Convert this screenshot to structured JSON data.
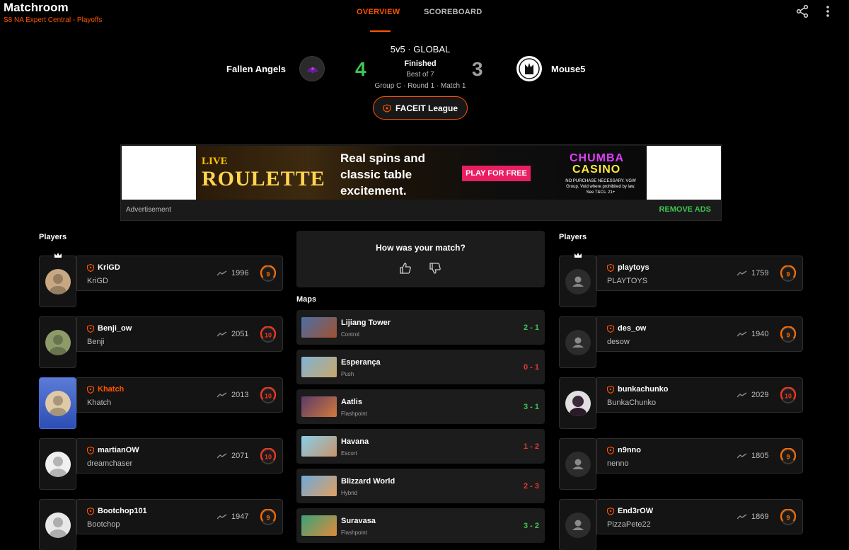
{
  "header": {
    "title": "Matchroom",
    "subtitle": "S8 NA Expert Central - Playoffs",
    "tabs": [
      {
        "label": "OVERVIEW",
        "active": true
      },
      {
        "label": "SCOREBOARD",
        "active": false
      }
    ],
    "icons": [
      "share-icon",
      "more-vertical-icon"
    ]
  },
  "match": {
    "mode": "5v5 · GLOBAL",
    "status": "Finished",
    "best_of": "Best of 7",
    "round_info": "Group C · Round 1 · Match 1",
    "league": "FACEIT League",
    "team1": {
      "name": "Fallen Angels",
      "score": "4",
      "color": "#3ec453"
    },
    "team2": {
      "name": "Mouse5",
      "score": "3",
      "color": "#9e9e9e"
    }
  },
  "ad": {
    "label": "Advertisement",
    "remove": "REMOVE ADS",
    "banner": {
      "live": "LIVE",
      "roulette": "ROULETTE",
      "headline": "Real spins and classic table excitement.",
      "cta": "PLAY FOR FREE",
      "brand1": "CHUMBA",
      "brand2": "CASINO",
      "fine1": "NO PURCHASE NECESSARY. VGW",
      "fine2": "Group. Void where prohibited by law.",
      "fine3": "See T&Cs. 21+"
    }
  },
  "players_label": "Players",
  "team1_players": [
    {
      "nick": "KriGD",
      "name": "KriGD",
      "elo": "1996",
      "level": "9",
      "highlight": false,
      "crown": true
    },
    {
      "nick": "Benji_ow",
      "name": "Benji",
      "elo": "2051",
      "level": "10",
      "highlight": false,
      "crown": false
    },
    {
      "nick": "Khatch",
      "name": "Khatch",
      "elo": "2013",
      "level": "10",
      "highlight": true,
      "crown": false
    },
    {
      "nick": "martianOW",
      "name": "dreamchaser",
      "elo": "2071",
      "level": "10",
      "highlight": false,
      "crown": false
    },
    {
      "nick": "Bootchop101",
      "name": "Bootchop",
      "elo": "1947",
      "level": "9",
      "highlight": false,
      "crown": false
    }
  ],
  "team2_players": [
    {
      "nick": "playtoys",
      "name": "PLAYTOYS",
      "elo": "1759",
      "level": "9",
      "highlight": false,
      "crown": true
    },
    {
      "nick": "des_ow",
      "name": "desow",
      "elo": "1940",
      "level": "9",
      "highlight": false,
      "crown": false
    },
    {
      "nick": "bunkachunko",
      "name": "BunkaChunko",
      "elo": "2029",
      "level": "10",
      "highlight": false,
      "crown": false
    },
    {
      "nick": "n9nno",
      "name": "nenno",
      "elo": "1805",
      "level": "9",
      "highlight": false,
      "crown": false
    },
    {
      "nick": "End3rOW",
      "name": "PizzaPete22",
      "elo": "1869",
      "level": "9",
      "highlight": false,
      "crown": false
    }
  ],
  "rating": {
    "title": "How was your match?",
    "icons": [
      "thumbs-up-icon",
      "thumbs-down-icon"
    ]
  },
  "maps_label": "Maps",
  "maps": [
    {
      "name": "Lijiang Tower",
      "mode": "Control",
      "score": "2 - 1",
      "win": true
    },
    {
      "name": "Esperança",
      "mode": "Push",
      "score": "0 - 1",
      "win": false
    },
    {
      "name": "Aatlis",
      "mode": "Flashpoint",
      "score": "3 - 1",
      "win": true
    },
    {
      "name": "Havana",
      "mode": "Escort",
      "score": "1 - 2",
      "win": false
    },
    {
      "name": "Blizzard World",
      "mode": "Hybrid",
      "score": "2 - 3",
      "win": false
    },
    {
      "name": "Suravasa",
      "mode": "Flashpoint",
      "score": "3 - 2",
      "win": true
    }
  ],
  "colors": {
    "accent": "#ff5500",
    "win": "#3ec453",
    "loss": "#e53935",
    "level9": "#ff6d00",
    "level10": "#f4381c"
  }
}
